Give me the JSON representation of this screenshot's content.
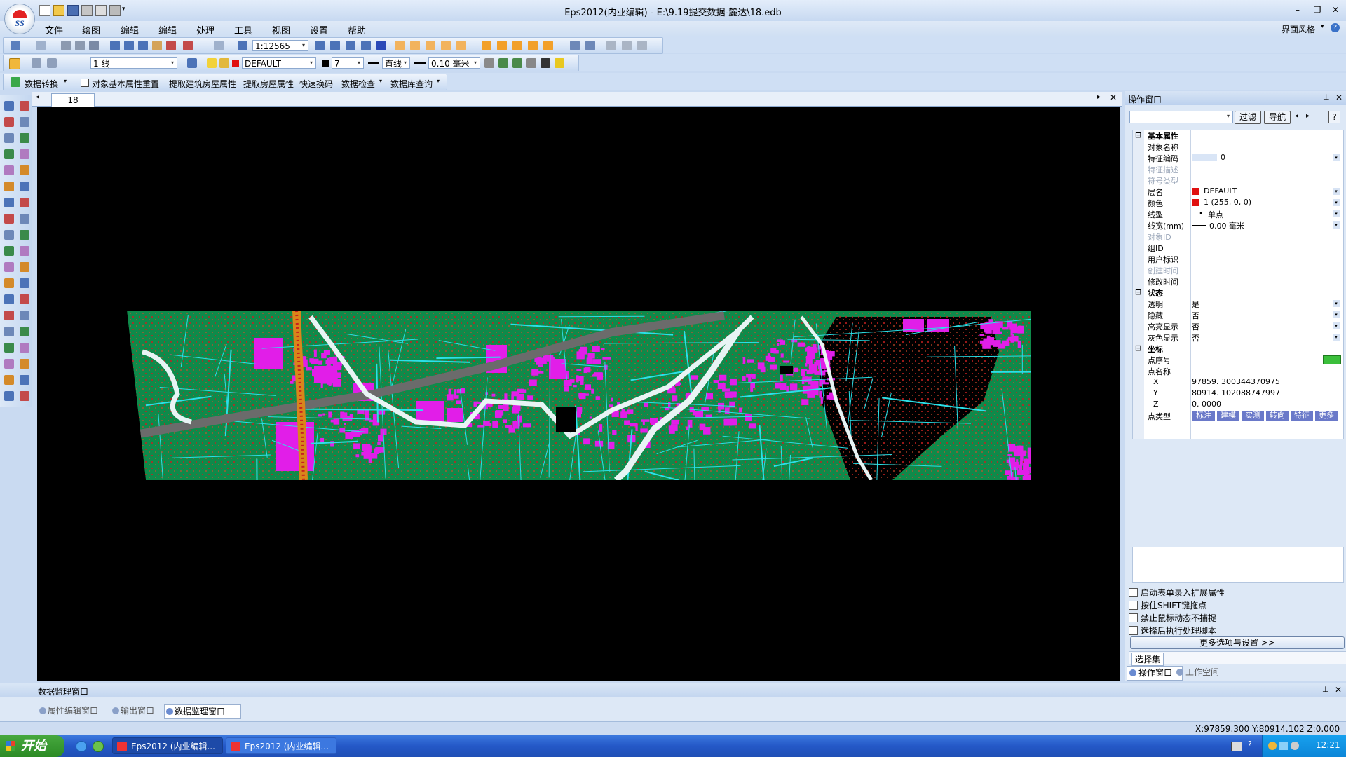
{
  "title": {
    "text": "Eps2012(内业编辑)  -  E:\\9.19提交数据-麓达\\18.edb",
    "logo_text": "SS",
    "right_label": "界面风格"
  },
  "menu": [
    "文件",
    "绘图",
    "编辑",
    "编辑",
    "处理",
    "工具",
    "视图",
    "设置",
    "帮助"
  ],
  "toolbar1": {
    "scale": "1:12565"
  },
  "toolbar2": {
    "linetype_field": "1 线",
    "layer_name": "DEFAULT",
    "color_value": "7",
    "line_style": "直线",
    "line_width": "0.10 毫米"
  },
  "toolbar3": {
    "items": [
      "数据转换",
      "对象基本属性重置",
      "提取建筑房屋属性",
      "提取房屋属性",
      "快速换码",
      "数据检查",
      "数据库查询"
    ]
  },
  "document": {
    "tab": "18"
  },
  "right_panel": {
    "title": "操作窗口",
    "filter_btn": "过滤",
    "nav_btn": "导航",
    "help_btn": "?",
    "sections": {
      "basic": "基本属性",
      "state": "状态",
      "coords": "坐标"
    },
    "props": [
      {
        "label": "对象名称",
        "value": ""
      },
      {
        "label": "特征编码",
        "value": "0"
      },
      {
        "label": "特征描述",
        "value": ""
      },
      {
        "label": "符号类型",
        "value": ""
      },
      {
        "label": "层名",
        "value": "DEFAULT"
      },
      {
        "label": "颜色",
        "value": "1  (255, 0, 0)"
      },
      {
        "label": "线型",
        "value": "单点"
      },
      {
        "label": "线宽(mm)",
        "value": "0.00 毫米"
      },
      {
        "label": "对象ID",
        "value": ""
      },
      {
        "label": "组ID",
        "value": ""
      },
      {
        "label": "用户标识",
        "value": ""
      },
      {
        "label": "创建时间",
        "value": ""
      },
      {
        "label": "修改时间",
        "value": ""
      }
    ],
    "state_props": [
      {
        "label": "透明",
        "value": "是"
      },
      {
        "label": "隐藏",
        "value": "否"
      },
      {
        "label": "高亮显示",
        "value": "否"
      },
      {
        "label": "灰色显示",
        "value": "否"
      }
    ],
    "coord_props": [
      {
        "label": "点序号",
        "value": ""
      },
      {
        "label": "点名称",
        "value": ""
      },
      {
        "label": "X",
        "value": "97859. 300344370975"
      },
      {
        "label": "Y",
        "value": "80914. 102088747997"
      },
      {
        "label": "Z",
        "value": "0. 0000"
      }
    ],
    "point_type_label": "点类型",
    "point_type_buttons": [
      "标注",
      "建模",
      "实测",
      "转向",
      "特征",
      "更多"
    ],
    "options": [
      "启动表单录入扩展属性",
      "按住SHIFT键拖点",
      "禁止鼠标动态不捕捉",
      "选择后执行处理脚本"
    ],
    "more_button": "更多选项与设置 >>",
    "selection_label": "选择集",
    "tabs": [
      "操作窗口",
      "工作空间"
    ]
  },
  "bottom_panel": {
    "title": "数据监理窗口",
    "tabs": [
      "属性编辑窗口",
      "输出窗口",
      "数据监理窗口"
    ]
  },
  "status": {
    "coords": "X:97859.300 Y:80914.102 Z:0.000"
  },
  "taskbar": {
    "start": "开始",
    "tasks": [
      "Eps2012 (内业编辑...",
      "Eps2012 (内业编辑..."
    ],
    "clock": "12:21"
  },
  "colors": {
    "map_green": "#0f8a4a",
    "map_magenta": "#e11ee8",
    "map_cyan": "#2be0e8",
    "map_red_points": "#c81f1f"
  }
}
